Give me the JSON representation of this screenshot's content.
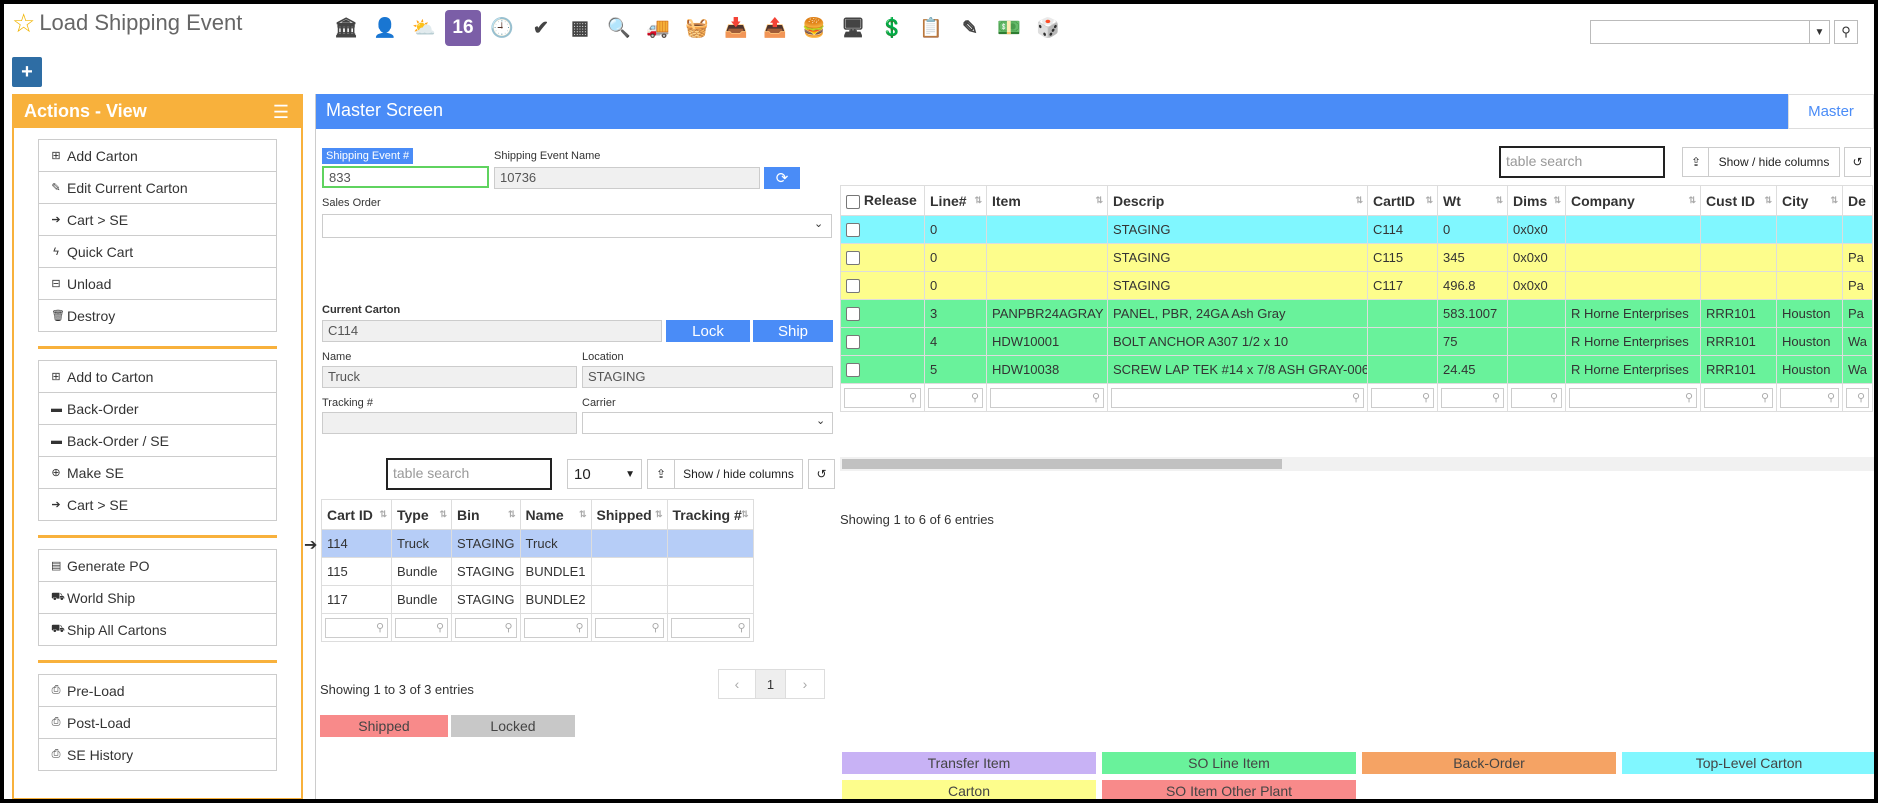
{
  "app": {
    "title": "Load Shipping Event"
  },
  "toolbar": {
    "icons": [
      {
        "name": "bank-icon",
        "glyph": "🏛",
        "bg": "#ffffff"
      },
      {
        "name": "user-icon",
        "glyph": "👤",
        "bg": "#ffffff"
      },
      {
        "name": "weather-icon",
        "glyph": "⛅",
        "bg": "#ffffff"
      },
      {
        "name": "calendar-icon",
        "glyph": "16",
        "bg": "#7b5ea7"
      },
      {
        "name": "clock-icon",
        "glyph": "🕘",
        "bg": "#ffffff"
      },
      {
        "name": "check-icon",
        "glyph": "✔",
        "bg": "#ffffff"
      },
      {
        "name": "keyboard-icon",
        "glyph": "▦",
        "bg": "#ffffff"
      },
      {
        "name": "search-icon",
        "glyph": "🔍",
        "bg": "#ffffff"
      },
      {
        "name": "truck-icon",
        "glyph": "🚚",
        "bg": "#ffffff"
      },
      {
        "name": "basket-icon",
        "glyph": "🧺",
        "bg": "#ffffff"
      },
      {
        "name": "download-box-icon",
        "glyph": "📥",
        "bg": "#ffffff"
      },
      {
        "name": "upload-box-icon",
        "glyph": "📤",
        "bg": "#ffffff"
      },
      {
        "name": "hamburger-icon",
        "glyph": "🍔",
        "bg": "#ffffff"
      },
      {
        "name": "screen-icon",
        "glyph": "🖥",
        "bg": "#ffffff"
      },
      {
        "name": "money-bubble-icon",
        "glyph": "💲",
        "bg": "#ffffff"
      },
      {
        "name": "clipboard-icon",
        "glyph": "📋",
        "bg": "#ffffff"
      },
      {
        "name": "pen-paper-icon",
        "glyph": "✎",
        "bg": "#ffffff"
      },
      {
        "name": "cash-icon",
        "glyph": "💵",
        "bg": "#ffffff"
      },
      {
        "name": "dice-icon",
        "glyph": "🎲",
        "bg": "#ffffff"
      }
    ]
  },
  "actions": {
    "title": "Actions - View",
    "groups": [
      [
        {
          "label": "Add Carton",
          "icon": "plus-square-icon",
          "glyph": "⊞"
        },
        {
          "label": "Edit Current Carton",
          "icon": "pencil-icon",
          "glyph": "✎"
        },
        {
          "label": "Cart > SE",
          "icon": "arrow-right-icon",
          "glyph": "➔"
        },
        {
          "label": "Quick Cart",
          "icon": "bolt-icon",
          "glyph": "ϟ"
        },
        {
          "label": "Unload",
          "icon": "minus-square-icon",
          "glyph": "⊟"
        },
        {
          "label": "Destroy",
          "icon": "trash-icon",
          "glyph": "🗑"
        }
      ],
      [
        {
          "label": "Add to Carton",
          "icon": "plus-square-icon",
          "glyph": "⊞"
        },
        {
          "label": "Back-Order",
          "icon": "archive-icon",
          "glyph": "▬"
        },
        {
          "label": "Back-Order / SE",
          "icon": "archive-icon",
          "glyph": "▬"
        },
        {
          "label": "Make SE",
          "icon": "plus-circle-icon",
          "glyph": "⊕"
        },
        {
          "label": "Cart > SE",
          "icon": "arrow-right-icon",
          "glyph": "➔"
        }
      ],
      [
        {
          "label": "Generate PO",
          "icon": "file-icon",
          "glyph": "▤"
        },
        {
          "label": "World Ship",
          "icon": "truck-icon",
          "glyph": "⛟"
        },
        {
          "label": "Ship All Cartons",
          "icon": "truck-icon",
          "glyph": "⛟"
        }
      ],
      [
        {
          "label": "Pre-Load",
          "icon": "print-icon",
          "glyph": "⎙"
        },
        {
          "label": "Post-Load",
          "icon": "print-icon",
          "glyph": "⎙"
        },
        {
          "label": "SE History",
          "icon": "print-icon",
          "glyph": "⎙"
        }
      ]
    ]
  },
  "master": {
    "title": "Master Screen",
    "tab": "Master"
  },
  "form": {
    "se_label": "Shipping Event #",
    "se_value": "833",
    "se_name_label": "Shipping Event Name",
    "se_name_value": "10736",
    "sales_order_label": "Sales Order",
    "sales_order_value": "",
    "current_carton_label": "Current Carton",
    "current_carton_value": "C114",
    "lock": "Lock",
    "ship": "Ship",
    "name_label": "Name",
    "name_value": "Truck",
    "location_label": "Location",
    "location_value": "STAGING",
    "tracking_label": "Tracking #",
    "tracking_value": "",
    "carrier_label": "Carrier",
    "carrier_value": ""
  },
  "cart_table": {
    "search_placeholder": "table search",
    "page_size": "10",
    "show_hide": "Show / hide columns",
    "columns": [
      "Cart ID",
      "Type",
      "Bin",
      "Name",
      "Shipped",
      "Tracking #"
    ],
    "rows": [
      [
        "114",
        "Truck",
        "STAGING",
        "Truck",
        "",
        ""
      ],
      [
        "115",
        "Bundle",
        "STAGING",
        "BUNDLE1",
        "",
        ""
      ],
      [
        "117",
        "Bundle",
        "STAGING",
        "BUNDLE2",
        "",
        ""
      ]
    ],
    "info": "Showing 1 to 3 of 3 entries",
    "prev": "‹",
    "page": "1",
    "next": "›",
    "legend_shipped": "Shipped",
    "legend_locked": "Locked",
    "colors": {
      "selected": "#b6cdf7",
      "shipped": "#f88a8a",
      "locked": "#c8c8c8"
    }
  },
  "items_table": {
    "search_placeholder": "table search",
    "show_hide": "Show / hide columns",
    "columns": [
      "Release",
      "Line#",
      "Item",
      "Descrip",
      "CartID",
      "Wt",
      "Dims",
      "Company",
      "Cust ID",
      "City",
      "De"
    ],
    "rows": [
      {
        "color": "#80f7ff",
        "cells": [
          "",
          "0",
          "",
          "STAGING",
          "C114",
          "0",
          "0x0x0",
          "",
          "",
          "",
          ""
        ]
      },
      {
        "color": "#fdfd8c",
        "cells": [
          "",
          "0",
          "",
          "STAGING",
          "C115",
          "345",
          "0x0x0",
          "",
          "",
          "",
          "Pa"
        ]
      },
      {
        "color": "#fdfd8c",
        "cells": [
          "",
          "0",
          "",
          "STAGING",
          "C117",
          "496.8",
          "0x0x0",
          "",
          "",
          "",
          "Pa"
        ]
      },
      {
        "color": "#69f29b",
        "cells": [
          "",
          "3",
          "PANPBR24AGRAY",
          "PANEL, PBR, 24GA Ash Gray",
          "",
          "583.1007",
          "",
          "R Horne Enterprises",
          "RRR101",
          "Houston",
          "Pa"
        ]
      },
      {
        "color": "#69f29b",
        "cells": [
          "",
          "4",
          "HDW10001",
          "BOLT ANCHOR A307 1/2 x 10",
          "",
          "75",
          "",
          "R Horne Enterprises",
          "RRR101",
          "Houston",
          "Wa"
        ]
      },
      {
        "color": "#69f29b",
        "cells": [
          "",
          "5",
          "HDW10038",
          "SCREW LAP TEK #14 x 7/8 ASH GRAY-006",
          "",
          "24.45",
          "",
          "R Horne Enterprises",
          "RRR101",
          "Houston",
          "Wa"
        ]
      }
    ],
    "info": "Showing 1 to 6 of 6 entries"
  },
  "legend": [
    {
      "label": "Transfer Item",
      "color": "#c8b2f5"
    },
    {
      "label": "SO Line Item",
      "color": "#69f29b"
    },
    {
      "label": "Back-Order",
      "color": "#f5a364"
    },
    {
      "label": "Top-Level Carton",
      "color": "#80f7ff"
    },
    {
      "label": "Carton",
      "color": "#fdfd8c"
    },
    {
      "label": "SO Item Other Plant",
      "color": "#f88a8a"
    }
  ]
}
